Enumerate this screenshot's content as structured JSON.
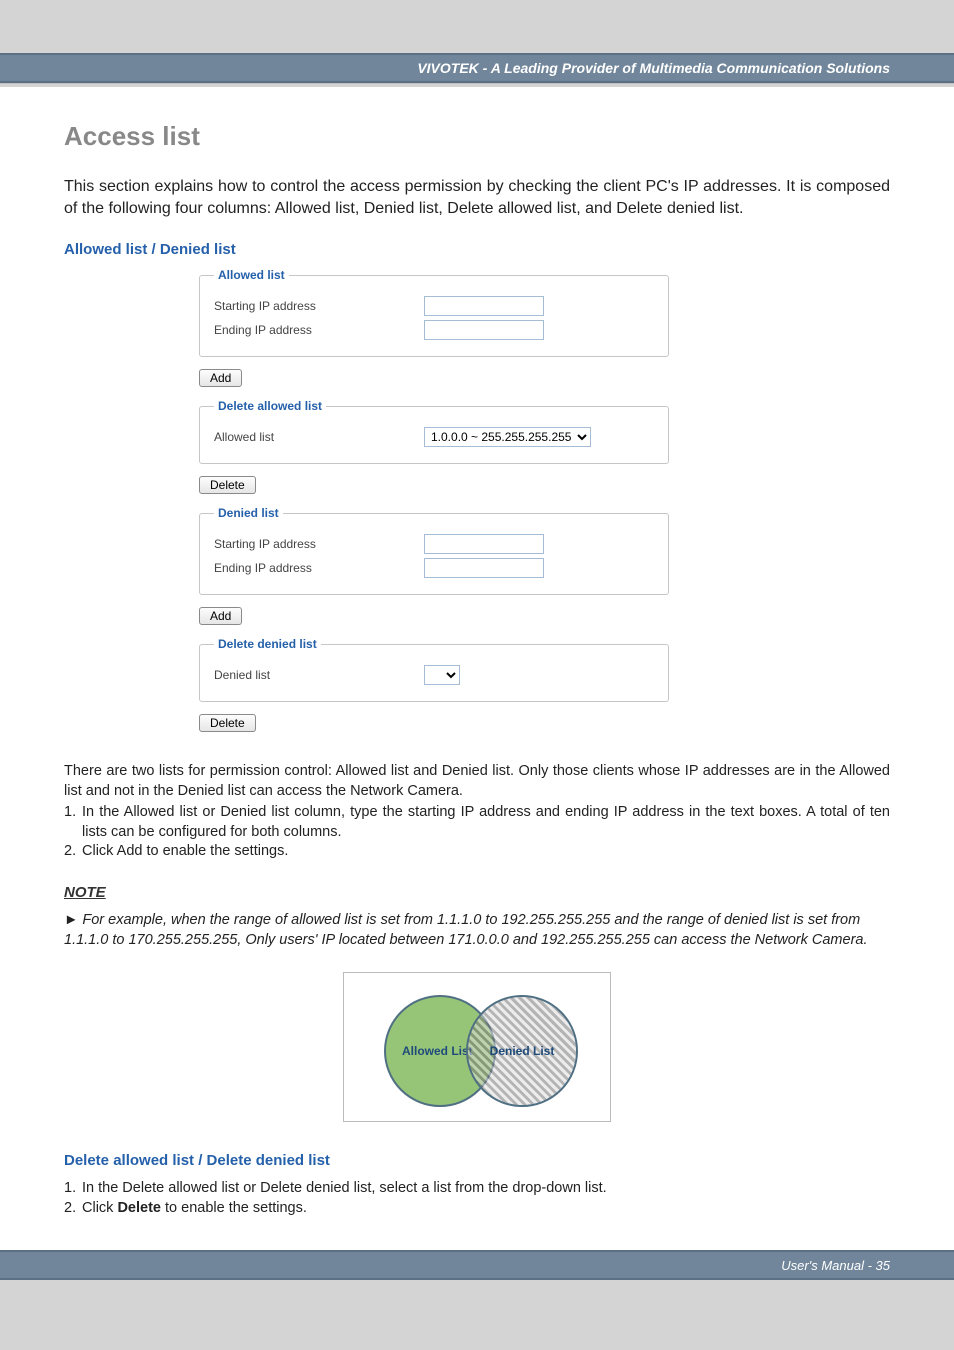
{
  "header": {
    "brand": "VIVOTEK - A Leading Provider of Multimedia Communication Solutions"
  },
  "page_title": "Access list",
  "intro": "This section explains how to control the access permission by checking the client PC's IP addresses. It is composed of the following four columns: Allowed list, Denied list, Delete allowed list, and Delete denied list.",
  "sect1_title": "Allowed list / Denied list",
  "ui": {
    "allowed": {
      "legend": "Allowed list",
      "start_label": "Starting IP address",
      "end_label": "Ending IP address",
      "add_btn": "Add"
    },
    "del_allowed": {
      "legend": "Delete allowed list",
      "list_label": "Allowed list",
      "option": "1.0.0.0 ~ 255.255.255.255",
      "delete_btn": "Delete"
    },
    "denied": {
      "legend": "Denied list",
      "start_label": "Starting IP address",
      "end_label": "Ending IP address",
      "add_btn": "Add"
    },
    "del_denied": {
      "legend": "Delete denied list",
      "list_label": "Denied list",
      "delete_btn": "Delete"
    }
  },
  "body1": "There are two lists for permission control: Allowed list and Denied list. Only those clients whose IP addresses are in the Allowed list and not in the Denied list can access the Network Camera.",
  "steps1": [
    "In the Allowed list or Denied list column, type the starting IP address and ending IP address in the text boxes. A total of ten lists can be configured for both columns.",
    "Click Add to enable the settings."
  ],
  "note_label": "NOTE",
  "note_body": "► For example, when the range of allowed list is set from 1.1.1.0 to 192.255.255.255 and the range of denied list is set from 1.1.1.0 to 170.255.255.255, Only users' IP located between 171.0.0.0 and 192.255.255.255 can access the Network Camera.",
  "venn": {
    "allowed": "Allowed List",
    "denied": "Denied List"
  },
  "sect2_title": "Delete allowed list / Delete denied list",
  "steps2_line1_pre": "In the Delete allowed list or Delete denied list, select a list from the drop-down list.",
  "steps2_line2_pre": "Click ",
  "steps2_line2_bold": "Delete",
  "steps2_line2_post": " to enable the settings.",
  "footer": "User's Manual - 35"
}
